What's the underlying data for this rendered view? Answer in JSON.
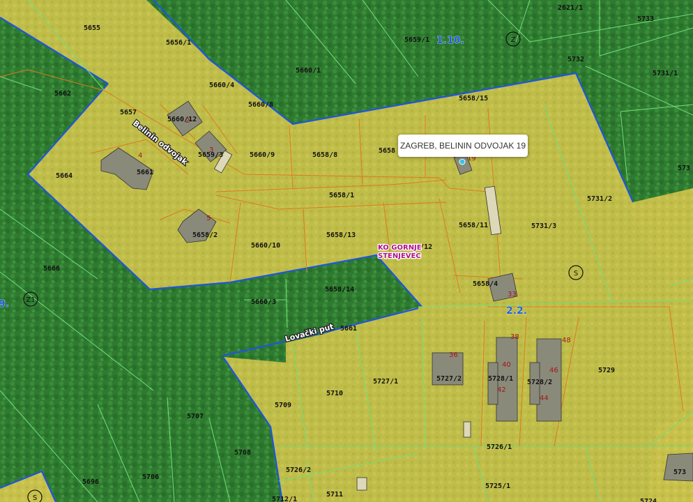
{
  "tooltip": {
    "address": "ZAGREB, BELININ ODVOJAK 19"
  },
  "streets": [
    "Belinin odvojak",
    "Lovački put"
  ],
  "zones": [
    "1.10.",
    "2.2.",
    "9."
  ],
  "zone_markers": [
    "Z",
    "Z1",
    "S",
    "S",
    "S"
  ],
  "cadastral_municipality": {
    "line1": "KO GORNJE",
    "line2": "STENJEVEC"
  },
  "parcels": [
    "2621/1",
    "5733",
    "5655",
    "5656/1",
    "5659/1",
    "5732",
    "5731/1",
    "5660/1",
    "5662",
    "5660/4",
    "5660/8",
    "5658/15",
    "5657",
    "5660/12",
    "5660/9",
    "5658/8",
    "5658",
    "5664",
    "5661",
    "5659/3",
    "5658/1",
    "5731/2",
    "5658/11",
    "5731/3",
    "5658/2",
    "5660/10",
    "5658/13",
    "5658/12",
    "5666",
    "5658/4",
    "5660/3",
    "5658/14",
    "5661",
    "5729",
    "5727/1",
    "5727/2",
    "5728/1",
    "5728/2",
    "5709",
    "5710",
    "5707",
    "5708",
    "5726/1",
    "5726/2",
    "5696",
    "5706",
    "5711",
    "5725/1",
    "573",
    "5712/1",
    "5724"
  ],
  "house_numbers": [
    "2",
    "3",
    "4",
    "5",
    "19",
    "33",
    "36",
    "38",
    "40",
    "42",
    "44",
    "46",
    "48"
  ],
  "colors": {
    "forest": "#2f7a2f",
    "buildable": "#c9c14a",
    "zone_border": "#1f55e0",
    "parcel_line_green": "#6fe07a",
    "parcel_line_orange": "#e07a1a",
    "building": "#8a8a7a"
  }
}
